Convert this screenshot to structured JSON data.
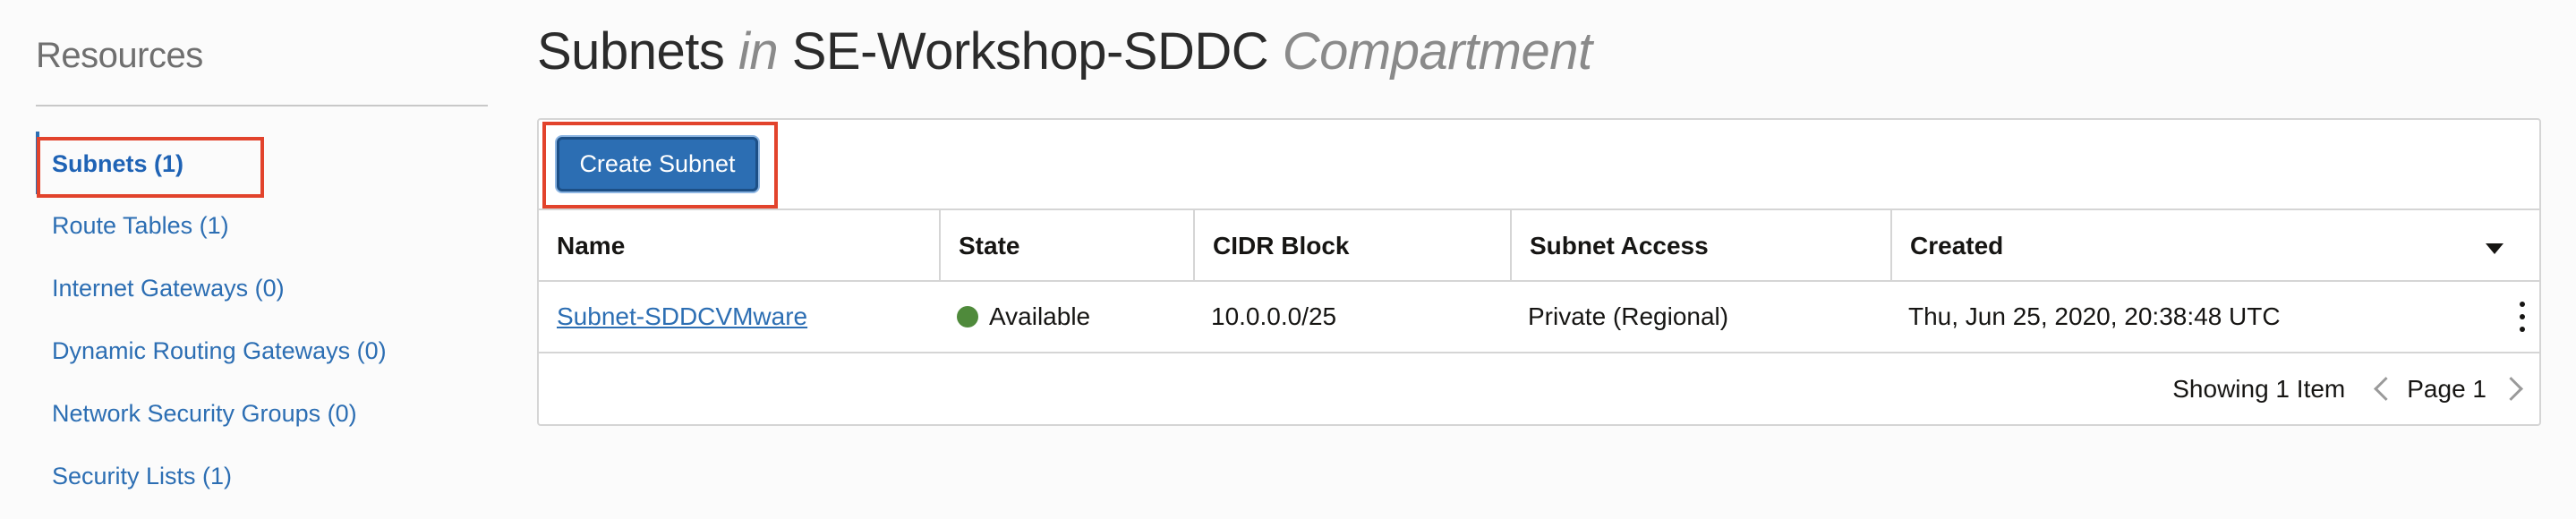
{
  "sidebar": {
    "title": "Resources",
    "items": [
      {
        "label": "Subnets (1)"
      },
      {
        "label": "Route Tables (1)"
      },
      {
        "label": "Internet Gateways (0)"
      },
      {
        "label": "Dynamic Routing Gateways (0)"
      },
      {
        "label": "Network Security Groups (0)"
      },
      {
        "label": "Security Lists (1)"
      }
    ]
  },
  "header": {
    "title_part1": "Subnets",
    "title_in": "in",
    "compartment_name": "SE-Workshop-SDDC",
    "compartment_label": "Compartment"
  },
  "toolbar": {
    "create_label": "Create Subnet"
  },
  "table": {
    "columns": [
      "Name",
      "State",
      "CIDR Block",
      "Subnet Access",
      "Created"
    ],
    "rows": [
      {
        "name": "Subnet-SDDCVMware",
        "state": "Available",
        "cidr": "10.0.0.0/25",
        "access": "Private (Regional)",
        "created": "Thu, Jun 25, 2020, 20:38:48 UTC"
      }
    ],
    "state_color": "#4f8a3b"
  },
  "footer": {
    "showing": "Showing 1 Item",
    "page": "Page 1"
  },
  "colors": {
    "accent": "#2c6eb3",
    "highlight": "#e2432c"
  }
}
